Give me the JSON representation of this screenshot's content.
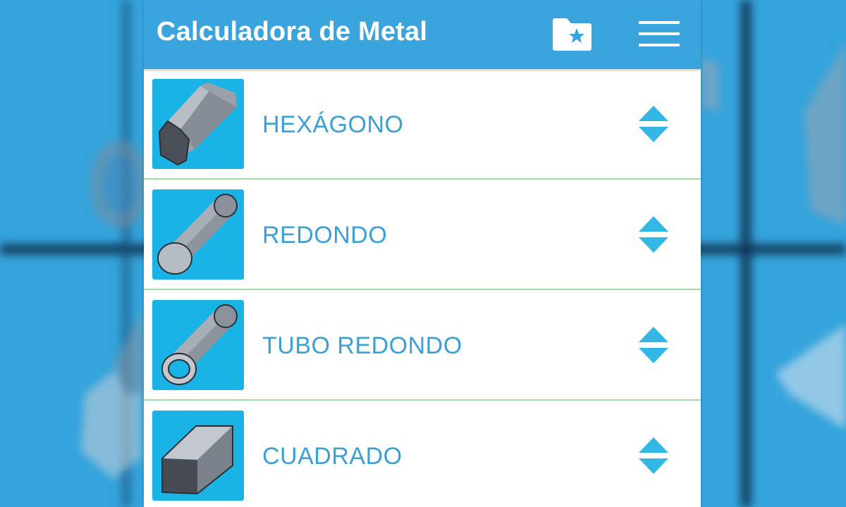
{
  "app": {
    "title": "Calculadora de Metal",
    "colors": {
      "app_bar": "#3aa5dc",
      "label": "#3aa0d6",
      "divider": "#9edba0",
      "thumb_bg": "#19b3e5",
      "sort_arrows": "#33b8e6"
    }
  },
  "toolbar": {
    "favorites_icon": "folder-star-icon",
    "menu_icon": "hamburger-menu-icon"
  },
  "shapes": [
    {
      "label": "HEXÁGONO",
      "icon": "hexagon-bar-icon"
    },
    {
      "label": "REDONDO",
      "icon": "round-bar-icon"
    },
    {
      "label": "TUBO REDONDO",
      "icon": "round-tube-icon"
    },
    {
      "label": "CUADRADO",
      "icon": "square-bar-icon"
    }
  ]
}
